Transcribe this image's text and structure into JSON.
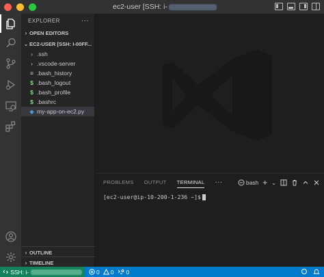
{
  "window": {
    "title_prefix": "ec2-user [SSH: i-"
  },
  "sidebar": {
    "header": "EXPLORER",
    "more": "···",
    "open_editors": "OPEN EDITORS",
    "folder": "EC2-USER [SSH: I-00FF...",
    "items": [
      {
        "label": ".ssh",
        "icon": "chevron-right-icon"
      },
      {
        "label": ".vscode-server",
        "icon": "chevron-right-icon"
      },
      {
        "label": ".bash_history",
        "icon": "text-file-icon"
      },
      {
        "label": ".bash_logout",
        "icon": "dollar-icon"
      },
      {
        "label": ".bash_profile",
        "icon": "dollar-icon"
      },
      {
        "label": ".bashrc",
        "icon": "dollar-icon"
      },
      {
        "label": "my-app-on-ec2.py",
        "icon": "python-icon"
      }
    ],
    "outline": "OUTLINE",
    "timeline": "TIMELINE"
  },
  "panel": {
    "tabs": [
      "PROBLEMS",
      "OUTPUT",
      "TERMINAL"
    ],
    "active_tab": "TERMINAL",
    "more": "···",
    "shell": "bash",
    "prompt": "[ec2-user@ip-10-200-1-236 ~]$"
  },
  "statusbar": {
    "remote": "SSH: i-",
    "errors": "0",
    "warnings": "0",
    "ports": "0"
  },
  "colors": {
    "accent": "#007acc",
    "remote": "#16825d",
    "activity_bar": "#333333",
    "sidebar": "#252526",
    "editor": "#1e1e1e"
  }
}
